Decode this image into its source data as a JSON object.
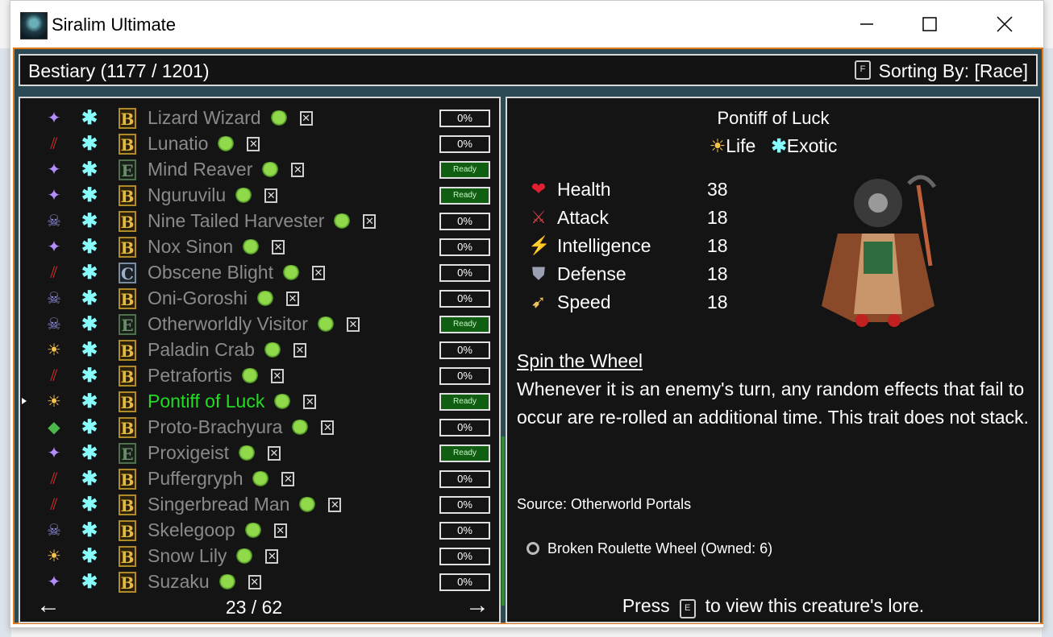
{
  "window": {
    "title": "Siralim Ultimate"
  },
  "header": {
    "title": "Bestiary (1177 / 1201)",
    "sort_key": "F",
    "sort_label": "Sorting By: [Race]"
  },
  "list": {
    "rows": [
      {
        "cls": "sorcery",
        "tier": "B",
        "name": "Lizard Wizard",
        "pct": "0%",
        "ready": false
      },
      {
        "cls": "chaos",
        "tier": "B",
        "name": "Lunatio",
        "pct": "0%",
        "ready": false
      },
      {
        "cls": "sorcery",
        "tier": "E",
        "name": "Mind Reaver",
        "pct": "Ready",
        "ready": true
      },
      {
        "cls": "sorcery",
        "tier": "B",
        "name": "Nguruvilu",
        "pct": "Ready",
        "ready": true
      },
      {
        "cls": "death",
        "tier": "B",
        "name": "Nine Tailed Harvester",
        "pct": "0%",
        "ready": false
      },
      {
        "cls": "sorcery",
        "tier": "B",
        "name": "Nox Sinon",
        "pct": "0%",
        "ready": false
      },
      {
        "cls": "chaos",
        "tier": "C",
        "name": "Obscene Blight",
        "pct": "0%",
        "ready": false
      },
      {
        "cls": "death",
        "tier": "B",
        "name": "Oni-Goroshi",
        "pct": "0%",
        "ready": false
      },
      {
        "cls": "death",
        "tier": "E",
        "name": "Otherworldly Visitor",
        "pct": "Ready",
        "ready": true
      },
      {
        "cls": "life",
        "tier": "B",
        "name": "Paladin Crab",
        "pct": "0%",
        "ready": false
      },
      {
        "cls": "chaos",
        "tier": "B",
        "name": "Petrafortis",
        "pct": "0%",
        "ready": false
      },
      {
        "cls": "life",
        "tier": "B",
        "name": "Pontiff of Luck",
        "pct": "Ready",
        "ready": true,
        "selected": true
      },
      {
        "cls": "nature",
        "tier": "B",
        "name": "Proto-Brachyura",
        "pct": "0%",
        "ready": false
      },
      {
        "cls": "sorcery",
        "tier": "E",
        "name": "Proxigeist",
        "pct": "Ready",
        "ready": true
      },
      {
        "cls": "chaos",
        "tier": "B",
        "name": "Puffergryph",
        "pct": "0%",
        "ready": false
      },
      {
        "cls": "chaos",
        "tier": "B",
        "name": "Singerbread Man",
        "pct": "0%",
        "ready": false
      },
      {
        "cls": "death",
        "tier": "B",
        "name": "Skelegoop",
        "pct": "0%",
        "ready": false
      },
      {
        "cls": "life",
        "tier": "B",
        "name": "Snow Lily",
        "pct": "0%",
        "ready": false
      },
      {
        "cls": "sorcery",
        "tier": "B",
        "name": "Suzaku",
        "pct": "0%",
        "ready": false
      }
    ],
    "page": "23 / 62",
    "prev": "←",
    "next": "→"
  },
  "detail": {
    "name": "Pontiff of Luck",
    "class": "Life",
    "race": "Exotic",
    "stats": [
      {
        "label": "Health",
        "value": "38",
        "icon": "heart-icon"
      },
      {
        "label": "Attack",
        "value": "18",
        "icon": "sword-icon"
      },
      {
        "label": "Intelligence",
        "value": "18",
        "icon": "lightning-icon"
      },
      {
        "label": "Defense",
        "value": "18",
        "icon": "shield-icon"
      },
      {
        "label": "Speed",
        "value": "18",
        "icon": "wing-icon"
      }
    ],
    "trait_name": "Spin the Wheel",
    "trait_desc": "Whenever it is an enemy's turn, any random effects that fail to occur are re-rolled an additional time. This trait does not stack.",
    "source": "Source: Otherworld Portals",
    "item": "Broken Roulette Wheel (Owned: 6)",
    "lore_prefix": "Press",
    "lore_key": "E",
    "lore_suffix": "to view this creature's lore."
  }
}
